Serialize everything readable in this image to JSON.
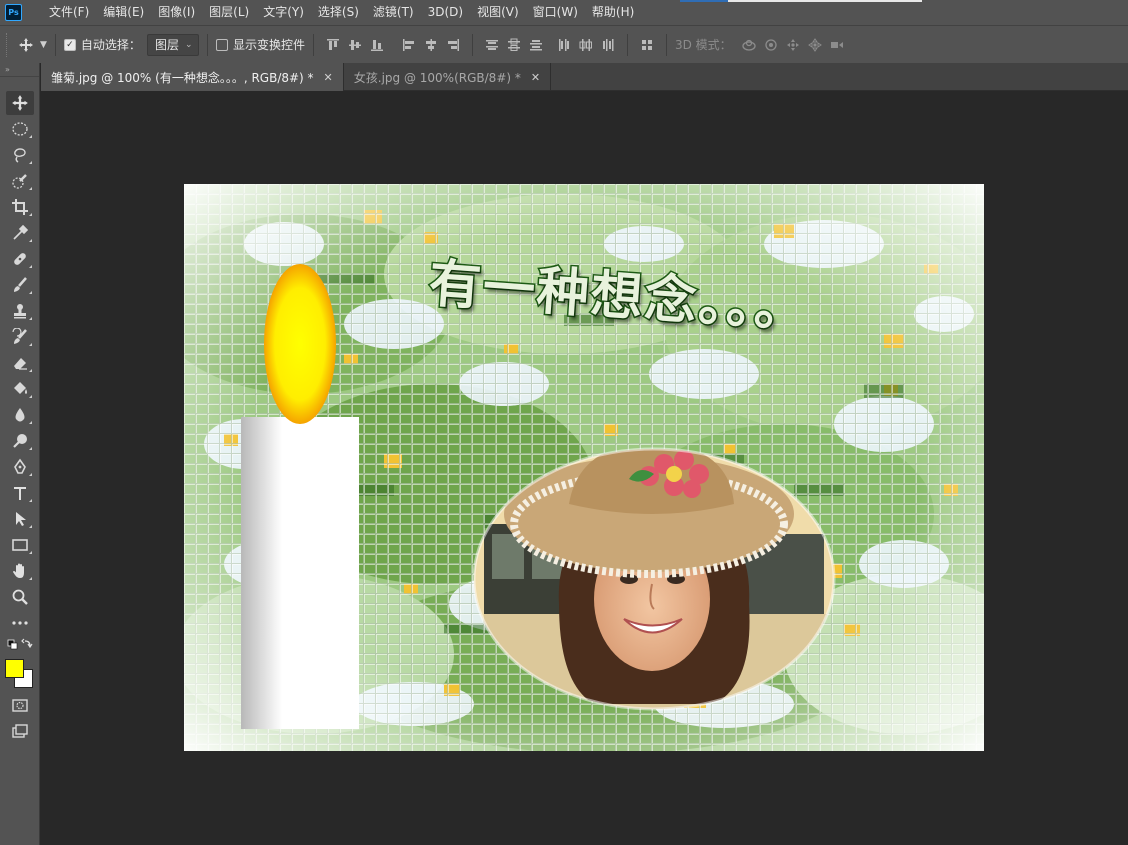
{
  "app": {
    "logo_text": "Ps"
  },
  "menu": {
    "items": [
      "文件(F)",
      "编辑(E)",
      "图像(I)",
      "图层(L)",
      "文字(Y)",
      "选择(S)",
      "滤镜(T)",
      "3D(D)",
      "视图(V)",
      "窗口(W)",
      "帮助(H)"
    ]
  },
  "options": {
    "auto_select_label": "自动选择：",
    "auto_select_checked": true,
    "auto_select_target": "图层",
    "show_transform_label": "显示变换控件",
    "show_transform_checked": false,
    "mode_3d_label": "3D 模式："
  },
  "tabs": [
    {
      "label": "雏菊.jpg @ 100% (有一种想念。。。, RGB/8#) *",
      "active": true
    },
    {
      "label": "女孩.jpg @ 100%(RGB/8#) *",
      "active": false
    }
  ],
  "tools": [
    "move-tool",
    "marquee-tool",
    "lasso-tool",
    "quick-selection-tool",
    "crop-tool",
    "eyedropper-tool",
    "healing-brush-tool",
    "brush-tool",
    "clone-stamp-tool",
    "history-brush-tool",
    "eraser-tool",
    "paint-bucket-tool",
    "blur-tool",
    "dodge-tool",
    "pen-tool",
    "type-tool",
    "path-selection-tool",
    "rectangle-tool",
    "hand-tool",
    "zoom-tool",
    "more-tools"
  ],
  "colors": {
    "foreground": "#ffff00",
    "background": "#ffffff",
    "ui_dark": "#535353",
    "canvas_bg": "#282828"
  },
  "artwork": {
    "title_text": "有一种想念。。。"
  }
}
